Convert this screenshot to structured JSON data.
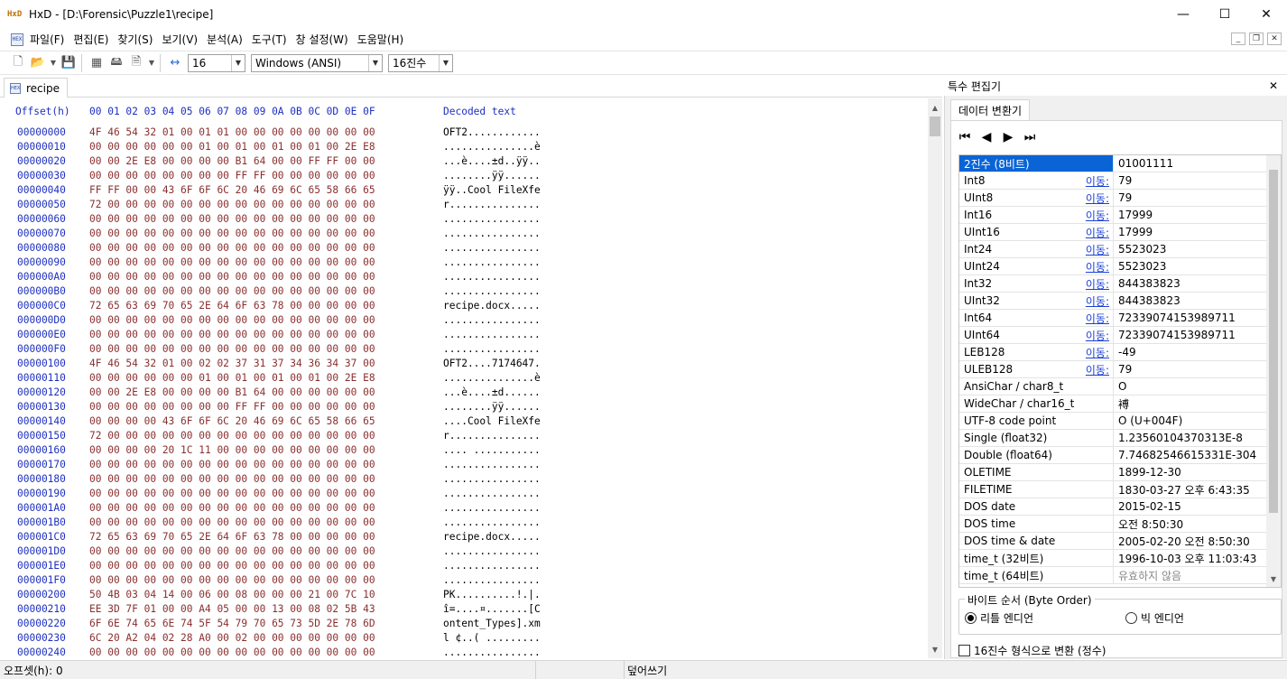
{
  "window": {
    "title": "HxD - [D:\\Forensic\\Puzzle1\\recipe]",
    "minimize": "—",
    "maximize": "☐",
    "close": "✕"
  },
  "menu": [
    "파일(F)",
    "편집(E)",
    "찾기(S)",
    "보기(V)",
    "분석(A)",
    "도구(T)",
    "창 설정(W)",
    "도움말(H)"
  ],
  "toolbar": {
    "bytes_per_row": "16",
    "charset": "Windows (ANSI)",
    "offset_base": "16진수"
  },
  "tab": {
    "name": "recipe"
  },
  "hex_header": {
    "offset": "Offset(h)",
    "columns": "00 01 02 03 04 05 06 07 08 09 0A 0B 0C 0D 0E 0F",
    "decoded": "Decoded text"
  },
  "hex_rows": [
    {
      "off": "00000000",
      "hex": "4F 46 54 32 01 00 01 01 00 00 00 00 00 00 00 00",
      "txt": "OFT2............"
    },
    {
      "off": "00000010",
      "hex": "00 00 00 00 00 00 01 00 01 00 01 00 01 00 2E E8",
      "txt": "...............è"
    },
    {
      "off": "00000020",
      "hex": "00 00 2E E8 00 00 00 00 B1 64 00 00 FF FF 00 00",
      "txt": "...è....±d..ÿÿ.."
    },
    {
      "off": "00000030",
      "hex": "00 00 00 00 00 00 00 00 FF FF 00 00 00 00 00 00",
      "txt": "........ÿÿ......"
    },
    {
      "off": "00000040",
      "hex": "FF FF 00 00 43 6F 6F 6C 20 46 69 6C 65 58 66 65",
      "txt": "ÿÿ..Cool FileXfe"
    },
    {
      "off": "00000050",
      "hex": "72 00 00 00 00 00 00 00 00 00 00 00 00 00 00 00",
      "txt": "r..............."
    },
    {
      "off": "00000060",
      "hex": "00 00 00 00 00 00 00 00 00 00 00 00 00 00 00 00",
      "txt": "................"
    },
    {
      "off": "00000070",
      "hex": "00 00 00 00 00 00 00 00 00 00 00 00 00 00 00 00",
      "txt": "................"
    },
    {
      "off": "00000080",
      "hex": "00 00 00 00 00 00 00 00 00 00 00 00 00 00 00 00",
      "txt": "................"
    },
    {
      "off": "00000090",
      "hex": "00 00 00 00 00 00 00 00 00 00 00 00 00 00 00 00",
      "txt": "................"
    },
    {
      "off": "000000A0",
      "hex": "00 00 00 00 00 00 00 00 00 00 00 00 00 00 00 00",
      "txt": "................"
    },
    {
      "off": "000000B0",
      "hex": "00 00 00 00 00 00 00 00 00 00 00 00 00 00 00 00",
      "txt": "................"
    },
    {
      "off": "000000C0",
      "hex": "72 65 63 69 70 65 2E 64 6F 63 78 00 00 00 00 00",
      "txt": "recipe.docx....."
    },
    {
      "off": "000000D0",
      "hex": "00 00 00 00 00 00 00 00 00 00 00 00 00 00 00 00",
      "txt": "................"
    },
    {
      "off": "000000E0",
      "hex": "00 00 00 00 00 00 00 00 00 00 00 00 00 00 00 00",
      "txt": "................"
    },
    {
      "off": "000000F0",
      "hex": "00 00 00 00 00 00 00 00 00 00 00 00 00 00 00 00",
      "txt": "................"
    },
    {
      "off": "00000100",
      "hex": "4F 46 54 32 01 00 02 02 37 31 37 34 36 34 37 00",
      "txt": "OFT2....7174647."
    },
    {
      "off": "00000110",
      "hex": "00 00 00 00 00 00 01 00 01 00 01 00 01 00 2E E8",
      "txt": "...............è"
    },
    {
      "off": "00000120",
      "hex": "00 00 2E E8 00 00 00 00 B1 64 00 00 00 00 00 00",
      "txt": "...è....±d......"
    },
    {
      "off": "00000130",
      "hex": "00 00 00 00 00 00 00 00 FF FF 00 00 00 00 00 00",
      "txt": "........ÿÿ......"
    },
    {
      "off": "00000140",
      "hex": "00 00 00 00 43 6F 6F 6C 20 46 69 6C 65 58 66 65",
      "txt": "....Cool FileXfe"
    },
    {
      "off": "00000150",
      "hex": "72 00 00 00 00 00 00 00 00 00 00 00 00 00 00 00",
      "txt": "r..............."
    },
    {
      "off": "00000160",
      "hex": "00 00 00 00 20 1C 11 00 00 00 00 00 00 00 00 00",
      "txt": ".... ..........."
    },
    {
      "off": "00000170",
      "hex": "00 00 00 00 00 00 00 00 00 00 00 00 00 00 00 00",
      "txt": "................"
    },
    {
      "off": "00000180",
      "hex": "00 00 00 00 00 00 00 00 00 00 00 00 00 00 00 00",
      "txt": "................"
    },
    {
      "off": "00000190",
      "hex": "00 00 00 00 00 00 00 00 00 00 00 00 00 00 00 00",
      "txt": "................"
    },
    {
      "off": "000001A0",
      "hex": "00 00 00 00 00 00 00 00 00 00 00 00 00 00 00 00",
      "txt": "................"
    },
    {
      "off": "000001B0",
      "hex": "00 00 00 00 00 00 00 00 00 00 00 00 00 00 00 00",
      "txt": "................"
    },
    {
      "off": "000001C0",
      "hex": "72 65 63 69 70 65 2E 64 6F 63 78 00 00 00 00 00",
      "txt": "recipe.docx....."
    },
    {
      "off": "000001D0",
      "hex": "00 00 00 00 00 00 00 00 00 00 00 00 00 00 00 00",
      "txt": "................"
    },
    {
      "off": "000001E0",
      "hex": "00 00 00 00 00 00 00 00 00 00 00 00 00 00 00 00",
      "txt": "................"
    },
    {
      "off": "000001F0",
      "hex": "00 00 00 00 00 00 00 00 00 00 00 00 00 00 00 00",
      "txt": "................"
    },
    {
      "off": "00000200",
      "hex": "50 4B 03 04 14 00 06 00 08 00 00 00 21 00 7C 10",
      "txt": "PK..........!.|."
    },
    {
      "off": "00000210",
      "hex": "EE 3D 7F 01 00 00 A4 05 00 00 13 00 08 02 5B 43",
      "txt": "î=....¤.......[C"
    },
    {
      "off": "00000220",
      "hex": "6F 6E 74 65 6E 74 5F 54 79 70 65 73 5D 2E 78 6D",
      "txt": "ontent_Types].xm"
    },
    {
      "off": "00000230",
      "hex": "6C 20 A2 04 02 28 A0 00 02 00 00 00 00 00 00 00",
      "txt": "l ¢..( ........."
    },
    {
      "off": "00000240",
      "hex": "00 00 00 00 00 00 00 00 00 00 00 00 00 00 00 00",
      "txt": "................"
    }
  ],
  "panel": {
    "title": "특수 편집기",
    "tab": "데이터 변환기",
    "rows": [
      {
        "name": "2진수 (8비트)",
        "value": "01001111",
        "selected": true
      },
      {
        "name": "Int8",
        "go": "이동:",
        "value": "79"
      },
      {
        "name": "UInt8",
        "go": "이동:",
        "value": "79"
      },
      {
        "name": "Int16",
        "go": "이동:",
        "value": "17999"
      },
      {
        "name": "UInt16",
        "go": "이동:",
        "value": "17999"
      },
      {
        "name": "Int24",
        "go": "이동:",
        "value": "5523023"
      },
      {
        "name": "UInt24",
        "go": "이동:",
        "value": "5523023"
      },
      {
        "name": "Int32",
        "go": "이동:",
        "value": "844383823"
      },
      {
        "name": "UInt32",
        "go": "이동:",
        "value": "844383823"
      },
      {
        "name": "Int64",
        "go": "이동:",
        "value": "72339074153989711"
      },
      {
        "name": "UInt64",
        "go": "이동:",
        "value": "72339074153989711"
      },
      {
        "name": "LEB128",
        "go": "이동:",
        "value": "-49"
      },
      {
        "name": "ULEB128",
        "go": "이동:",
        "value": "79"
      },
      {
        "name": "AnsiChar / char8_t",
        "value": "O"
      },
      {
        "name": "WideChar / char16_t",
        "value": "䙏"
      },
      {
        "name": "UTF-8 code point",
        "value": "O (U+004F)"
      },
      {
        "name": "Single (float32)",
        "value": "1.23560104370313E-8"
      },
      {
        "name": "Double (float64)",
        "value": "7.74682546615331E-304"
      },
      {
        "name": "OLETIME",
        "value": "1899-12-30"
      },
      {
        "name": "FILETIME",
        "value": "1830-03-27 오후 6:43:35"
      },
      {
        "name": "DOS date",
        "value": "2015-02-15"
      },
      {
        "name": "DOS time",
        "value": "오전 8:50:30"
      },
      {
        "name": "DOS time & date",
        "value": "2005-02-20 오전 8:50:30"
      },
      {
        "name": "time_t (32비트)",
        "value": "1996-10-03 오후 11:03:43"
      },
      {
        "name": "time_t (64비트)",
        "value": "유효하지 않음",
        "invalid": true
      }
    ],
    "byte_order_label": "바이트 순서 (Byte Order)",
    "little_endian": "리틀 엔디언",
    "big_endian": "빅 엔디언",
    "hex_integer_label": "16진수 형식으로 변환 (정수)"
  },
  "status": {
    "offset": "오프셋(h): 0",
    "mode": "덮어쓰기"
  }
}
